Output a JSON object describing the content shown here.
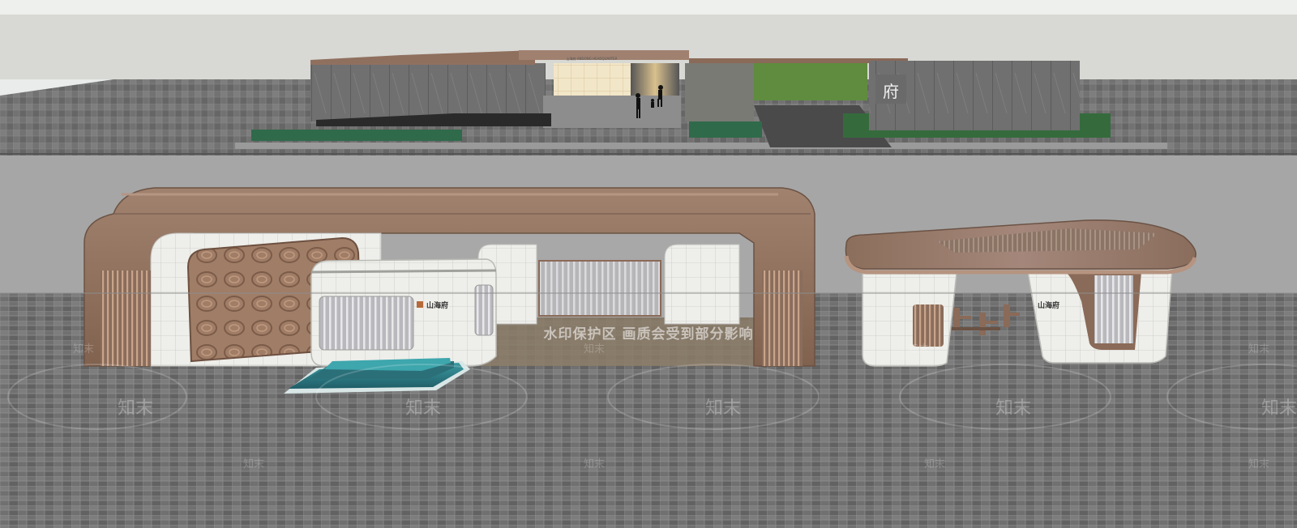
{
  "scene": {
    "colors": {
      "sky": "#dcdcd8",
      "background_wall": "#a3a3a3",
      "ground_tiles": "#6f6f6f",
      "roof_bronze": "#9a7a66",
      "panel_white": "#efefec",
      "stone_gray": "#6d6d6d",
      "lawn_green": "#5e8e3c",
      "water_teal": "#2e7f86"
    },
    "upper_model": {
      "sign_text": "山海府 ANDONG HEADQUARTER",
      "emblem_glyph": "府"
    },
    "main_gate": {
      "sign_logo": "山海府"
    },
    "guard_house": {
      "sign_logo": "山海府"
    },
    "watermark": {
      "text": "水印保护区  画质会受到部分影响",
      "logo": "知末",
      "logo_small": "知末"
    }
  }
}
